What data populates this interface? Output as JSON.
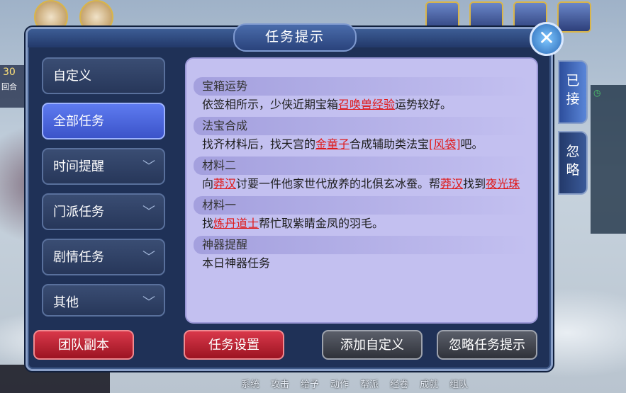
{
  "window": {
    "title": "任务提示"
  },
  "categories": [
    {
      "label": "自定义",
      "chevron": false
    },
    {
      "label": "全部任务",
      "chevron": false,
      "active": true
    },
    {
      "label": "时间提醒",
      "chevron": true
    },
    {
      "label": "门派任务",
      "chevron": true
    },
    {
      "label": "剧情任务",
      "chevron": true
    },
    {
      "label": "其他",
      "chevron": true
    }
  ],
  "side_tabs": [
    {
      "label": "已接"
    },
    {
      "label": "忽略"
    }
  ],
  "entries": [
    {
      "title": "宝箱运势",
      "parts": [
        "依签相所示，少侠近期宝箱",
        "召唤兽经验",
        "运势较好。"
      ]
    },
    {
      "title": "法宝合成",
      "parts": [
        "找齐材料后，找天宫的",
        "金童子",
        "合成辅助类法宝",
        "[风袋]",
        "吧。"
      ]
    },
    {
      "title": "材料二",
      "parts": [
        "向",
        "莽汉",
        "讨要一件他家世代放养的北俱玄冰蚕。帮",
        "莽汉",
        "找到",
        "夜光珠"
      ]
    },
    {
      "title": "材料一",
      "parts": [
        "找",
        "炼丹道士",
        "帮忙取紫睛金凤的羽毛。"
      ]
    },
    {
      "title": "神器提醒",
      "parts": [
        "本日神器任务"
      ]
    }
  ],
  "buttons": {
    "team_dungeon": "团队副本",
    "task_settings": "任务设置",
    "add_custom": "添加自定义",
    "ignore_tips": "忽略任务提示"
  },
  "hud": {
    "left_number": "30",
    "left_text": "回合",
    "bottom_menu": [
      "系统",
      "攻击",
      "给予",
      "动作",
      "帮派",
      "经卷",
      "成就",
      "组队"
    ]
  },
  "colors": {
    "highlight": "#e01818",
    "panel": "#c3c0f0",
    "active_tab": "#4a63dd"
  }
}
